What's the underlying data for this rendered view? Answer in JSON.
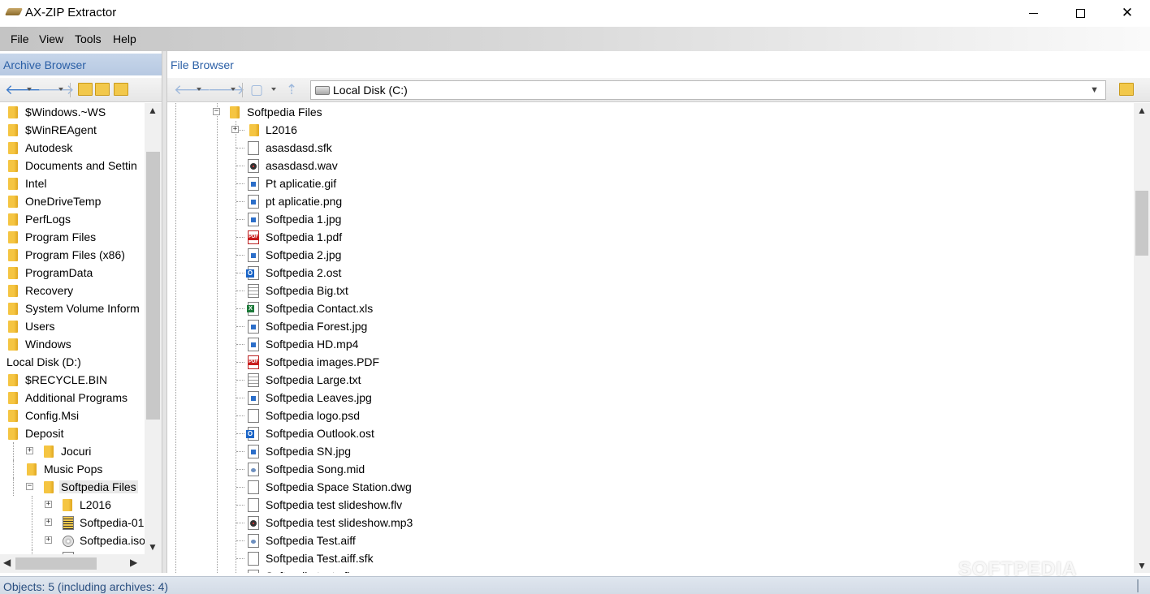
{
  "window": {
    "title": "AX-ZIP Extractor"
  },
  "menu": {
    "file": "File",
    "view": "View",
    "tools": "Tools",
    "help": "Help"
  },
  "archive_browser": {
    "title": "Archive Browser",
    "items": [
      {
        "label": "$Windows.~WS"
      },
      {
        "label": "$WinREAgent"
      },
      {
        "label": "Autodesk"
      },
      {
        "label": "Documents and Settin"
      },
      {
        "label": "Intel"
      },
      {
        "label": "OneDriveTemp"
      },
      {
        "label": "PerfLogs"
      },
      {
        "label": "Program Files"
      },
      {
        "label": "Program Files (x86)"
      },
      {
        "label": "ProgramData"
      },
      {
        "label": "Recovery"
      },
      {
        "label": "System Volume Inform"
      },
      {
        "label": "Users"
      },
      {
        "label": "Windows"
      },
      {
        "label": "Local Disk (D:)"
      },
      {
        "label": "$RECYCLE.BIN"
      },
      {
        "label": "Additional Programs"
      },
      {
        "label": "Config.Msi"
      },
      {
        "label": "Deposit"
      },
      {
        "label": "Jocuri"
      },
      {
        "label": "Music Pops"
      },
      {
        "label": "Softpedia Files"
      },
      {
        "label": "L2016"
      },
      {
        "label": "Softpedia-01.zi"
      },
      {
        "label": "Softpedia.iso"
      },
      {
        "label": "Softpedi"
      }
    ]
  },
  "file_browser": {
    "title": "File Browser",
    "drive": "Local Disk (C:)",
    "root": "Softpedia Files",
    "items": [
      {
        "label": "L2016",
        "icon": "folder-icon"
      },
      {
        "label": "asasdasd.sfk",
        "icon": "file-icon"
      },
      {
        "label": "asasdasd.wav",
        "icon": "audio-file-icon"
      },
      {
        "label": "Pt aplicatie.gif",
        "icon": "image-file-icon"
      },
      {
        "label": "pt aplicatie.png",
        "icon": "image-file-icon"
      },
      {
        "label": "Softpedia 1.jpg",
        "icon": "image-file-icon"
      },
      {
        "label": "Softpedia 1.pdf",
        "icon": "pdf-file-icon"
      },
      {
        "label": "Softpedia 2.jpg",
        "icon": "image-file-icon"
      },
      {
        "label": "Softpedia 2.ost",
        "icon": "outlook-file-icon"
      },
      {
        "label": "Softpedia Big.txt",
        "icon": "text-file-icon"
      },
      {
        "label": "Softpedia Contact.xls",
        "icon": "excel-file-icon"
      },
      {
        "label": "Softpedia Forest.jpg",
        "icon": "image-file-icon"
      },
      {
        "label": "Softpedia HD.mp4",
        "icon": "video-file-icon"
      },
      {
        "label": "Softpedia images.PDF",
        "icon": "pdf-file-icon"
      },
      {
        "label": "Softpedia Large.txt",
        "icon": "text-file-icon"
      },
      {
        "label": "Softpedia Leaves.jpg",
        "icon": "image-file-icon"
      },
      {
        "label": "Softpedia logo.psd",
        "icon": "file-icon"
      },
      {
        "label": "Softpedia Outlook.ost",
        "icon": "outlook-file-icon"
      },
      {
        "label": "Softpedia SN.jpg",
        "icon": "image-file-icon"
      },
      {
        "label": "Softpedia Song.mid",
        "icon": "music-file-icon"
      },
      {
        "label": "Softpedia Space Station.dwg",
        "icon": "file-icon"
      },
      {
        "label": "Softpedia test slideshow.flv",
        "icon": "file-icon"
      },
      {
        "label": "Softpedia test slideshow.mp3",
        "icon": "audio-file-icon"
      },
      {
        "label": "Softpedia Test.aiff",
        "icon": "music-file-icon"
      },
      {
        "label": "Softpedia Test.aiff.sfk",
        "icon": "file-icon"
      },
      {
        "label": "Softpedia test.sfk",
        "icon": "file-icon"
      }
    ]
  },
  "status": {
    "text": "Objects: 5 (including archives: 4)"
  },
  "watermark": "SOFTPEDIA"
}
